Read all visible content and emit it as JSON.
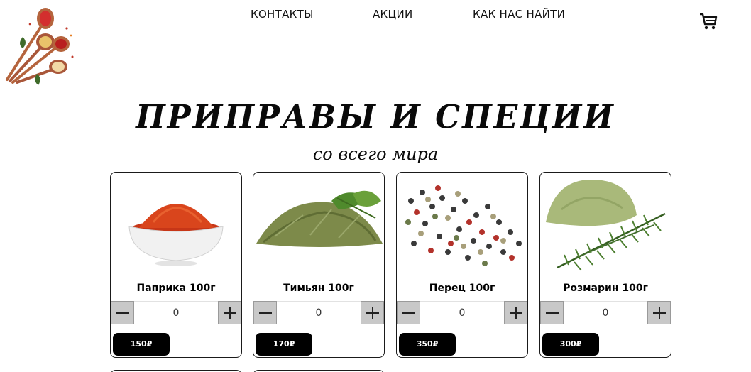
{
  "nav": {
    "contacts": "КОНТАКТЫ",
    "promotions": "АКЦИИ",
    "find_us": "КАК НАС НАЙТИ"
  },
  "hero": {
    "title": "ПРИПРАВЫ И СПЕЦИИ",
    "subtitle": "со всего мира"
  },
  "products": [
    {
      "name": "Паприка 100г",
      "qty": "0",
      "price": "150₽",
      "icon": "paprika-image"
    },
    {
      "name": "Тимьян 100г",
      "qty": "0",
      "price": "170₽",
      "icon": "thyme-image"
    },
    {
      "name": "Перец 100г",
      "qty": "0",
      "price": "350₽",
      "icon": "pepper-image"
    },
    {
      "name": "Розмарин 100г",
      "qty": "0",
      "price": "300₽",
      "icon": "rosemary-image"
    }
  ],
  "colors": {
    "accent": "#000000",
    "stepper": "#c8c8c8",
    "paprika": "#d9451c",
    "herb": "#6e8a3a"
  }
}
